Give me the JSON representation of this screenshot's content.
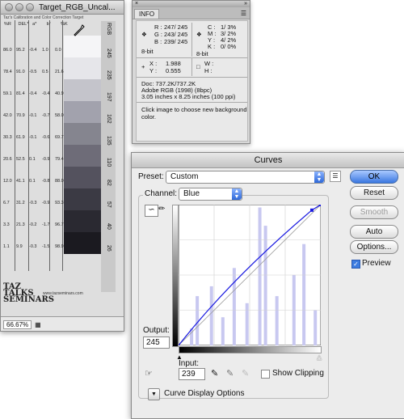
{
  "document": {
    "title": "Target_RGB_Uncal...",
    "caption": "Taz's Calibration and Color Correction Target",
    "columns": [
      "%R",
      "DEL*",
      "a*",
      "b*",
      "%K"
    ],
    "rows": [
      [
        "86.0",
        "95.2",
        "-0.4",
        "1.0",
        "0.0"
      ],
      [
        "78.4",
        "91.0",
        "-0.5",
        "0.5",
        "21.6"
      ],
      [
        "59.1",
        "81.4",
        "-0.4",
        "-0.4",
        "40.9"
      ],
      [
        "42.0",
        "70.9",
        "-0.1",
        "-0.7",
        "58.0"
      ],
      [
        "30.3",
        "61.9",
        "-0.1",
        "-0.6",
        "69.7"
      ],
      [
        "20.6",
        "52.5",
        "0.1",
        "-0.9",
        "79.4"
      ],
      [
        "12.0",
        "41.1",
        "0.1",
        "-0.8",
        "88.0"
      ],
      [
        "6.7",
        "31.2",
        "-0.3",
        "-0.9",
        "93.3"
      ],
      [
        "3.3",
        "21.3",
        "-0.2",
        "-1.7",
        "96.7"
      ],
      [
        "1.1",
        "9.9",
        "-0.3",
        "-1.5",
        "98.9"
      ]
    ],
    "rgb_header": "RGB",
    "rgb_values": [
      "245",
      "235",
      "197",
      "162",
      "135",
      "110",
      "82",
      "57",
      "40",
      "26"
    ],
    "swatch_colors": [
      "#f5f5f7",
      "#e6e6ea",
      "#c4c4cb",
      "#a2a2ad",
      "#85858f",
      "#6e6c78",
      "#54525e",
      "#3b3a44",
      "#2a2931",
      "#1b1a20"
    ],
    "logo": "TAZ TALKS SEMINARS",
    "url": "www.tazseminars.com",
    "zoom": "66.67%"
  },
  "info": {
    "tab": "INFO",
    "r_label": "R :",
    "r_value": "247/ 245",
    "g_label": "G :",
    "g_value": "243/ 245",
    "b_label": "B :",
    "b_value": "239/ 245",
    "c_label": "C :",
    "c_value": "1/  3%",
    "m_label": "M :",
    "m_value": "3/  2%",
    "y_label": "Y :",
    "y_value": "4/  2%",
    "k_label": "K :",
    "k_value": "0/  0%",
    "bit_left": "8-bit",
    "bit_right": "8-bit",
    "x_label": "X :",
    "x_value": "1.988",
    "y2_label": "Y :",
    "y2_value": "0.555",
    "w_label": "W :",
    "h_label": "H :",
    "doc_line": "Doc: 737.2K/737.2K",
    "profile_line": "Adobe RGB (1998) (8bpc)",
    "size_line": "3.05 inches x 8.25 inches (100 ppi)",
    "hint_line1": "Click image to choose new background",
    "hint_line2": "color."
  },
  "curves": {
    "title": "Curves",
    "preset_label": "Preset:",
    "preset_value": "Custom",
    "channel_label": "Channel:",
    "channel_value": "Blue",
    "output_label": "Output:",
    "output_value": "245",
    "input_label": "Input:",
    "input_value": "239",
    "show_clipping": "Show Clipping",
    "display_options": "Curve Display Options",
    "buttons": {
      "ok": "OK",
      "reset": "Reset",
      "smooth": "Smooth",
      "auto": "Auto",
      "options": "Options..."
    },
    "preview_label": "Preview",
    "preview_checked": true,
    "show_clipping_checked": false,
    "curve_points": [
      [
        0,
        0
      ],
      [
        239,
        245
      ],
      [
        255,
        255
      ]
    ],
    "colors": {
      "curve": "#1a1ae0",
      "histogram": "#c8c8f0",
      "accent": "#3a77e0"
    }
  }
}
